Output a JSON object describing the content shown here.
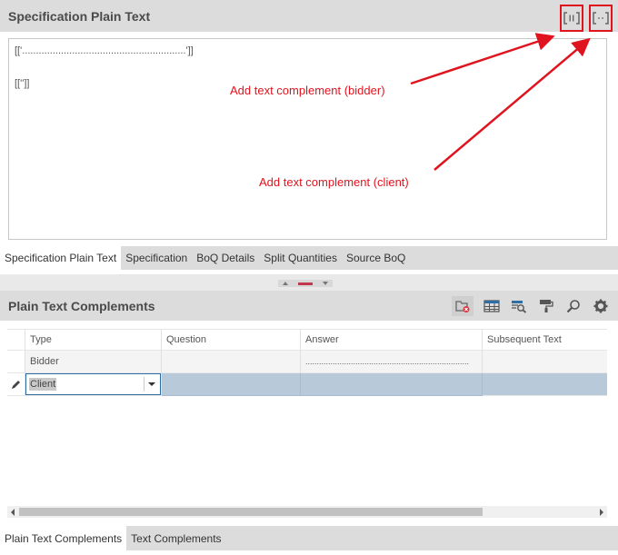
{
  "top_panel": {
    "title": "Specification Plain Text",
    "icons": [
      "bidder-complement-icon",
      "client-complement-icon"
    ],
    "content_line1": "[['...........................................................']]",
    "content_line2": "[['']]",
    "tabs": [
      "Specification Plain Text",
      "Specification",
      "BoQ Details",
      "Split Quantities",
      "Source BoQ"
    ],
    "active_tab": "Specification Plain Text"
  },
  "annotations": {
    "bidder": "Add text complement (bidder)",
    "client": "Add text complement (client)",
    "color": "#e0141e"
  },
  "bottom_panel": {
    "title": "Plain Text Complements",
    "toolbar_icons": [
      "delete-record-icon",
      "grid-layout-icon",
      "search-view-icon",
      "paint-roller-icon",
      "search-icon",
      "settings-gear-icon"
    ],
    "columns": [
      "Type",
      "Question",
      "Answer",
      "Subsequent Text"
    ],
    "rows": [
      {
        "type": "Bidder",
        "question": "",
        "answer": "........................................................................",
        "subsequent": ""
      },
      {
        "type": "Client",
        "question": "",
        "answer": "",
        "subsequent": ""
      }
    ],
    "tabs": [
      "Plain Text Complements",
      "Text Complements"
    ],
    "active_tab": "Plain Text Complements",
    "selected_row_color": "#b8c9da"
  }
}
